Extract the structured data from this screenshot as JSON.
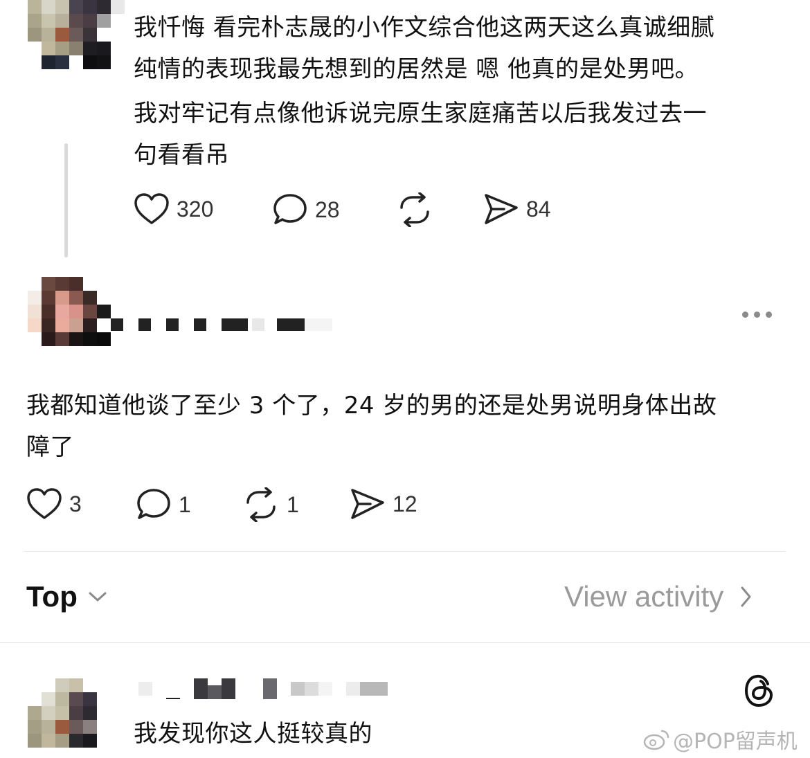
{
  "post1": {
    "text_line1": "我忏悔 看完朴志晟的小作文综合他这两天这么真诚细腻",
    "text_line2": "纯情的表现我最先想到的居然是 嗯 他真的是处男吧。",
    "text_line3": "我对牢记有点像他诉说完原生家庭痛苦以后我发过去一",
    "text_line4": "句看看吊",
    "likes": "320",
    "comments": "28",
    "shares": "84"
  },
  "post2": {
    "text_line1": "我都知道他谈了至少 3 个了，24 岁的男的还是处男说明身体出故",
    "text_line2": "障了",
    "likes": "3",
    "comments": "1",
    "reposts": "1",
    "shares": "12"
  },
  "sort_bar": {
    "sort_label": "Top",
    "activity_label": "View activity"
  },
  "post3": {
    "text": "我发现你这人挺较真的"
  },
  "watermark": {
    "text": "@POP留声机"
  },
  "icons": {
    "like": "heart-icon",
    "comment": "speech-bubble-icon",
    "repost": "repost-arrows-icon",
    "share": "send-icon",
    "more": "more-dots-icon",
    "threads": "threads-logo-icon",
    "chevron_down": "chevron-down-icon",
    "chevron_right": "chevron-right-icon"
  },
  "colors": {
    "text": "#111111",
    "muted": "#9a9a9a",
    "icon": "#222222",
    "divider": "#e5e5e5"
  }
}
